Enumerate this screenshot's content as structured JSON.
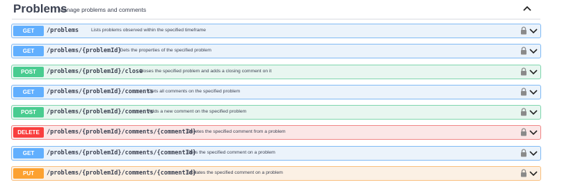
{
  "section": {
    "title": "Problems",
    "description": "Manage problems and comments"
  },
  "colors": {
    "get": "#61affe",
    "post": "#49cc90",
    "delete": "#f93e3e",
    "put": "#fca130"
  },
  "icons": {
    "collapse": "chevron-up-icon",
    "lock": "lock-icon",
    "expand": "chevron-down-icon"
  },
  "operations": [
    {
      "method": "GET",
      "path": "/problems",
      "summary": "Lists problems observed within the specified timeframe"
    },
    {
      "method": "GET",
      "path": "/problems/{problemId}",
      "summary": "Gets the properties of the specified problem"
    },
    {
      "method": "POST",
      "path": "/problems/{problemId}/close",
      "summary": "Closes the specified problem and adds a closing comment on it"
    },
    {
      "method": "GET",
      "path": "/problems/{problemId}/comments",
      "summary": "Gets all comments on the specified problem"
    },
    {
      "method": "POST",
      "path": "/problems/{problemId}/comments",
      "summary": "Adds a new comment on the specified problem"
    },
    {
      "method": "DELETE",
      "path": "/problems/{problemId}/comments/{commentId}",
      "summary": "Deletes the specified comment from a problem"
    },
    {
      "method": "GET",
      "path": "/problems/{problemId}/comments/{commentId}",
      "summary": "Gets the specified comment on a problem"
    },
    {
      "method": "PUT",
      "path": "/problems/{problemId}/comments/{commentId}",
      "summary": "Updates the specified comment on a problem"
    }
  ]
}
